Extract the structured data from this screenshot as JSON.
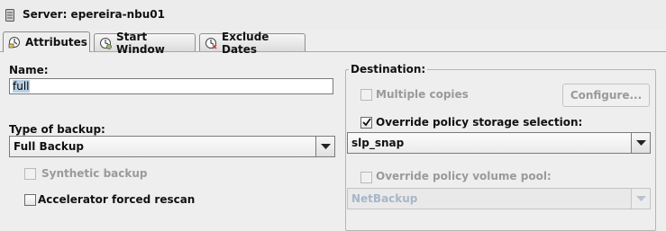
{
  "header": {
    "title": "Server: epereira-nbu01"
  },
  "tabs": [
    {
      "label": "Attributes"
    },
    {
      "label": "Start Window"
    },
    {
      "label": "Exclude Dates"
    }
  ],
  "attributes": {
    "name_label": "Name:",
    "name_value": "full",
    "type_label": "Type of backup:",
    "type_value": "Full Backup",
    "synthetic_label": "Synthetic backup",
    "synthetic_checked": false,
    "synthetic_enabled": false,
    "accelerator_label": "Accelerator forced rescan",
    "accelerator_checked": false
  },
  "destination": {
    "title": "Destination:",
    "multiple_copies_label": "Multiple copies",
    "multiple_copies_checked": false,
    "multiple_copies_enabled": false,
    "configure_label": "Configure...",
    "override_storage_label": "Override policy storage selection:",
    "override_storage_checked": true,
    "storage_value": "slp_snap",
    "override_volume_label": "Override policy volume pool:",
    "override_volume_checked": false,
    "override_volume_enabled": false,
    "volume_pool_value": "NetBackup"
  },
  "colors": {
    "window_bg": "#eeeeee",
    "text_selection": "#b8cfe5",
    "disabled_text": "#9a9a9a"
  },
  "icons": [
    "server-icon",
    "attributes-tab-icon",
    "start-window-tab-icon",
    "exclude-dates-tab-icon",
    "check-icon",
    "chevron-down-icon"
  ]
}
